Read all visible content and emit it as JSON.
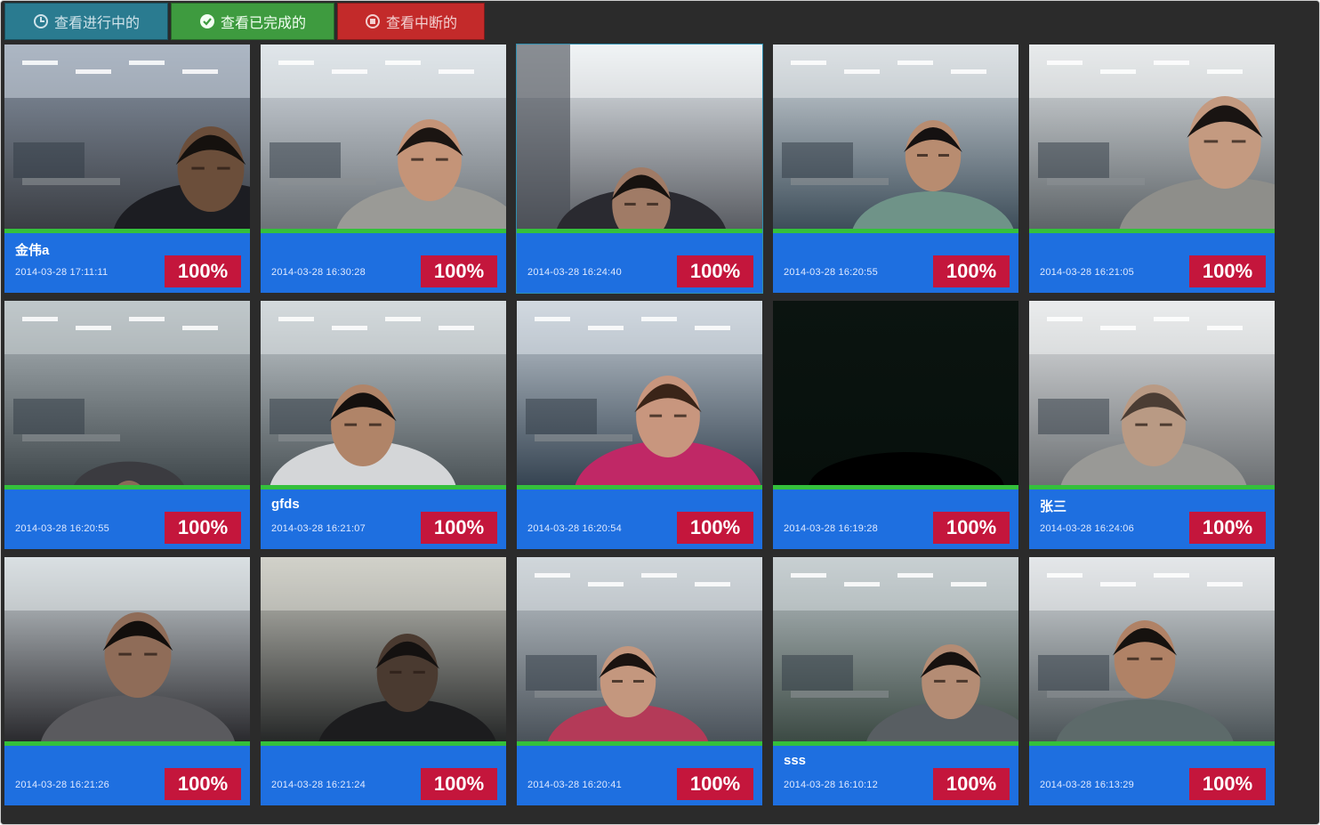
{
  "tabs": [
    {
      "label": "查看进行中的",
      "icon": "clock-icon",
      "color": "#2a7b90"
    },
    {
      "label": "查看已完成的",
      "icon": "check-circle-icon",
      "color": "#3e9b3f"
    },
    {
      "label": "查看中断的",
      "icon": "stop-circle-icon",
      "color": "#c32a2a"
    }
  ],
  "accent": {
    "info_bar": "#1e6fe0",
    "progress_badge": "#c4163c",
    "divider": "#34c03c"
  },
  "sessions": [
    {
      "name": "金伟a",
      "time": "2014-03-28 17:11:11",
      "progress": "100%"
    },
    {
      "name": "",
      "time": "2014-03-28 16:30:28",
      "progress": "100%"
    },
    {
      "name": "",
      "time": "2014-03-28 16:24:40",
      "progress": "100%"
    },
    {
      "name": "",
      "time": "2014-03-28 16:20:55",
      "progress": "100%"
    },
    {
      "name": "",
      "time": "2014-03-28 16:21:05",
      "progress": "100%"
    },
    {
      "name": "",
      "time": "2014-03-28 16:20:55",
      "progress": "100%"
    },
    {
      "name": "gfds",
      "time": "2014-03-28 16:21:07",
      "progress": "100%"
    },
    {
      "name": "",
      "time": "2014-03-28 16:20:54",
      "progress": "100%"
    },
    {
      "name": "",
      "time": "2014-03-28 16:19:28",
      "progress": "100%"
    },
    {
      "name": "张三",
      "time": "2014-03-28 16:24:06",
      "progress": "100%"
    },
    {
      "name": "",
      "time": "2014-03-28 16:21:26",
      "progress": "100%"
    },
    {
      "name": "",
      "time": "2014-03-28 16:21:24",
      "progress": "100%"
    },
    {
      "name": "",
      "time": "2014-03-28 16:20:41",
      "progress": "100%"
    },
    {
      "name": "sss",
      "time": "2014-03-28 16:10:12",
      "progress": "100%"
    },
    {
      "name": "",
      "time": "2014-03-28 16:13:29",
      "progress": "100%"
    }
  ]
}
